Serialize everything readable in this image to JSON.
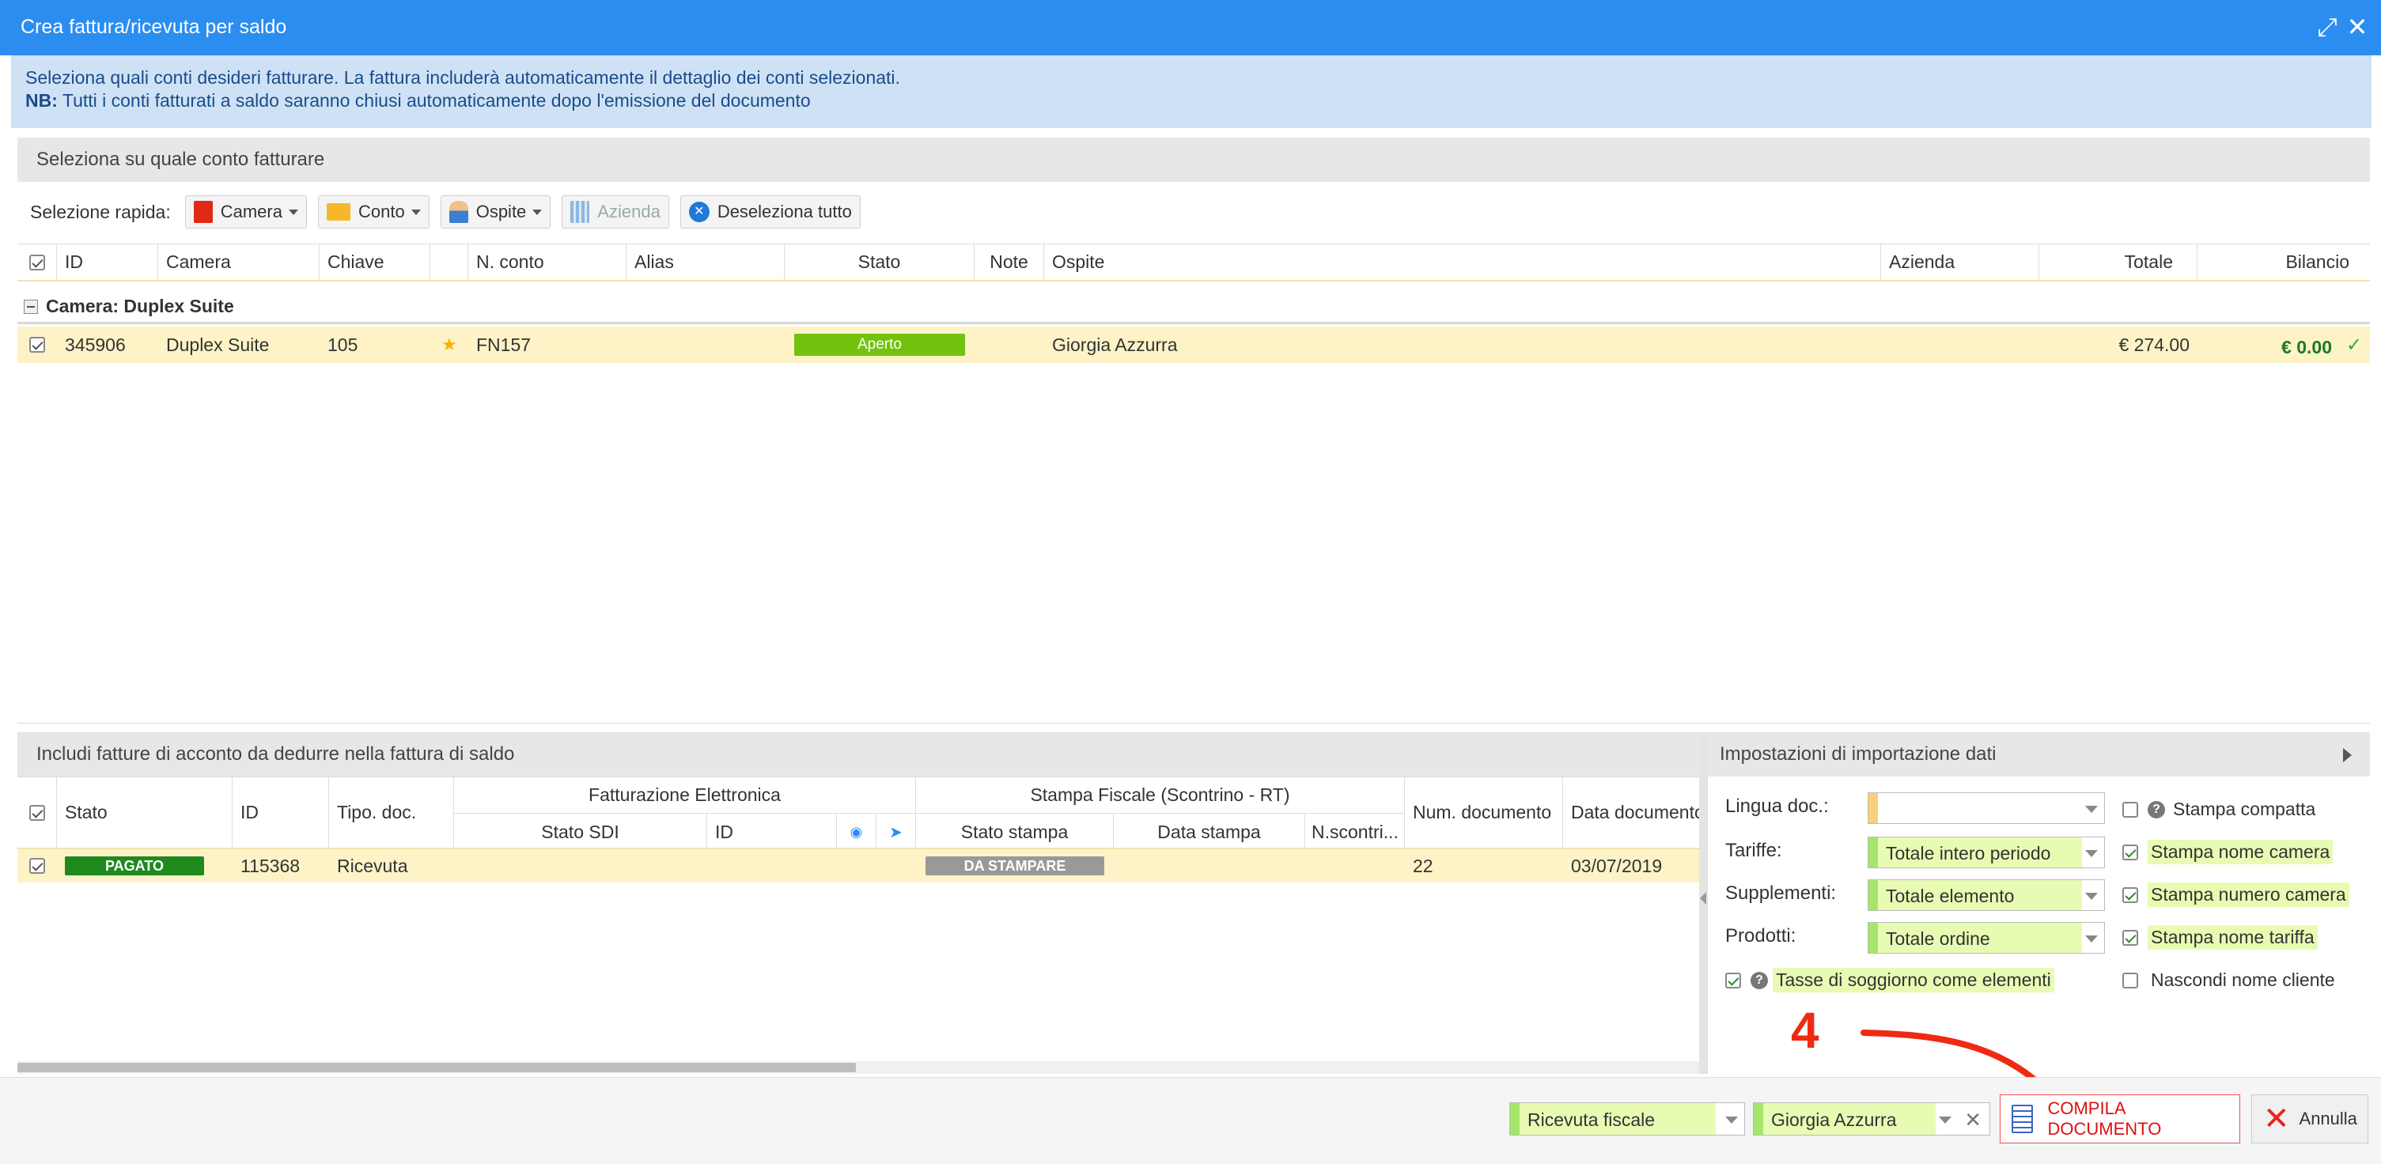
{
  "window": {
    "title": "Crea fattura/ricevuta per saldo"
  },
  "notice": {
    "line1": "Seleziona quali conti desideri fatturare. La fattura includerà automaticamente il dettaglio dei conti selezionati.",
    "nb_label": "NB:",
    "line2": "Tutti i conti fatturati a saldo saranno chiusi automaticamente dopo l'emissione del documento"
  },
  "accounts": {
    "section_title": "Seleziona su quale conto fatturare",
    "quick_label": "Selezione rapida:",
    "quick_buttons": {
      "camera": "Camera",
      "conto": "Conto",
      "ospite": "Ospite",
      "azienda": "Azienda",
      "deselect": "Deseleziona tutto"
    },
    "columns": {
      "id": "ID",
      "camera": "Camera",
      "chiave": "Chiave",
      "n_conto": "N. conto",
      "alias": "Alias",
      "stato": "Stato",
      "note": "Note",
      "ospite": "Ospite",
      "azienda": "Azienda",
      "totale": "Totale",
      "bilancio": "Bilancio"
    },
    "group_label": "Camera: Duplex Suite",
    "row": {
      "id": "345906",
      "camera": "Duplex Suite",
      "chiave": "105",
      "n_conto": "FN157",
      "stato": "Aperto",
      "ospite": "Giorgia Azzurra",
      "totale": "€ 274.00",
      "bilancio": "€ 0.00"
    }
  },
  "advances": {
    "section_title": "Includi fatture di acconto da dedurre nella fattura di saldo",
    "columns": {
      "stato": "Stato",
      "id": "ID",
      "tipo": "Tipo. doc.",
      "fe_group": "Fatturazione Elettronica",
      "stato_sdi": "Stato SDI",
      "fe_id": "ID",
      "sf_group": "Stampa Fiscale (Scontrino - RT)",
      "stato_stampa": "Stato stampa",
      "data_stampa": "Data stampa",
      "n_scontrino": "N.scontri...",
      "num_doc": "Num. documento",
      "data_doc": "Data documento"
    },
    "row": {
      "stato": "PAGATO",
      "id": "115368",
      "tipo": "Ricevuta",
      "stato_stampa": "DA STAMPARE",
      "num_doc": "22",
      "data_doc": "03/07/2019"
    }
  },
  "settings": {
    "section_title": "Impostazioni di importazione dati",
    "lingua_label": "Lingua doc.:",
    "lingua_value": "",
    "tariffe_label": "Tariffe:",
    "tariffe_value": "Totale intero periodo",
    "supplementi_label": "Supplementi:",
    "supplementi_value": "Totale elemento",
    "prodotti_label": "Prodotti:",
    "prodotti_value": "Totale ordine",
    "stampa_compatta": "Stampa compatta",
    "stampa_nome_camera": "Stampa nome camera",
    "stampa_numero_camera": "Stampa numero camera",
    "stampa_nome_tariffa": "Stampa nome tariffa",
    "tasse_soggiorno": "Tasse di soggiorno come elementi",
    "nascondi_nome_cliente": "Nascondi nome cliente"
  },
  "annotation": {
    "step": "4",
    "color": "#f02a12"
  },
  "footer": {
    "doc_type": "Ricevuta fiscale",
    "customer": "Giorgia Azzurra",
    "compile": "COMPILA DOCUMENTO",
    "cancel": "Annulla"
  },
  "colors": {
    "titlebar": "#2b8df0",
    "status_open": "#72c20e",
    "status_paid": "#1e8a1e",
    "status_print": "#999999",
    "balance": "#1e7a1e"
  }
}
